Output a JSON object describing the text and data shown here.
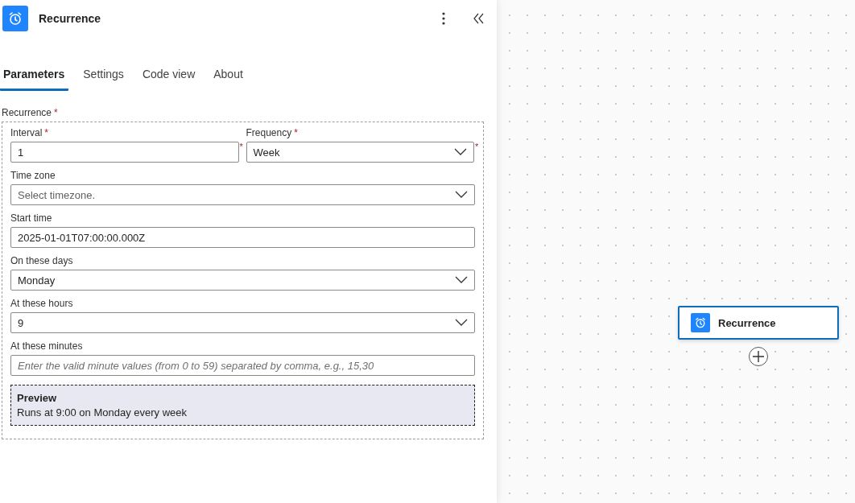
{
  "panel": {
    "title": "Recurrence"
  },
  "tabs": [
    {
      "label": "Parameters",
      "selected": true
    },
    {
      "label": "Settings",
      "selected": false
    },
    {
      "label": "Code view",
      "selected": false
    },
    {
      "label": "About",
      "selected": false
    }
  ],
  "group": {
    "label": "Recurrence",
    "label_mark": "*"
  },
  "field_rows": [
    [
      {
        "kind": "text",
        "label": "Interval",
        "label_mark": "*",
        "input_mark": "*",
        "value": "1"
      },
      {
        "kind": "dropdown",
        "label": "Frequency",
        "label_mark": "*",
        "input_mark": "*",
        "value": "Week"
      }
    ],
    [
      {
        "kind": "dropdown",
        "label": "Time zone",
        "placeholder": "Select timezone."
      }
    ],
    [
      {
        "kind": "text",
        "label": "Start time",
        "value": "2025-01-01T07:00:00.000Z"
      }
    ],
    [
      {
        "kind": "dropdown",
        "label": "On these days",
        "value": "Monday"
      }
    ],
    [
      {
        "kind": "dropdown",
        "label": "At these hours",
        "value": "9"
      }
    ],
    [
      {
        "kind": "text",
        "label": "At these minutes",
        "placeholder": "Enter the valid minute values (from 0 to 59) separated by comma, e.g., 15,30"
      }
    ]
  ],
  "preview": {
    "title": "Preview",
    "text": "Runs at 9:00 on Monday every week"
  },
  "canvas": {
    "node": {
      "title": "Recurrence",
      "selected": true
    }
  }
}
